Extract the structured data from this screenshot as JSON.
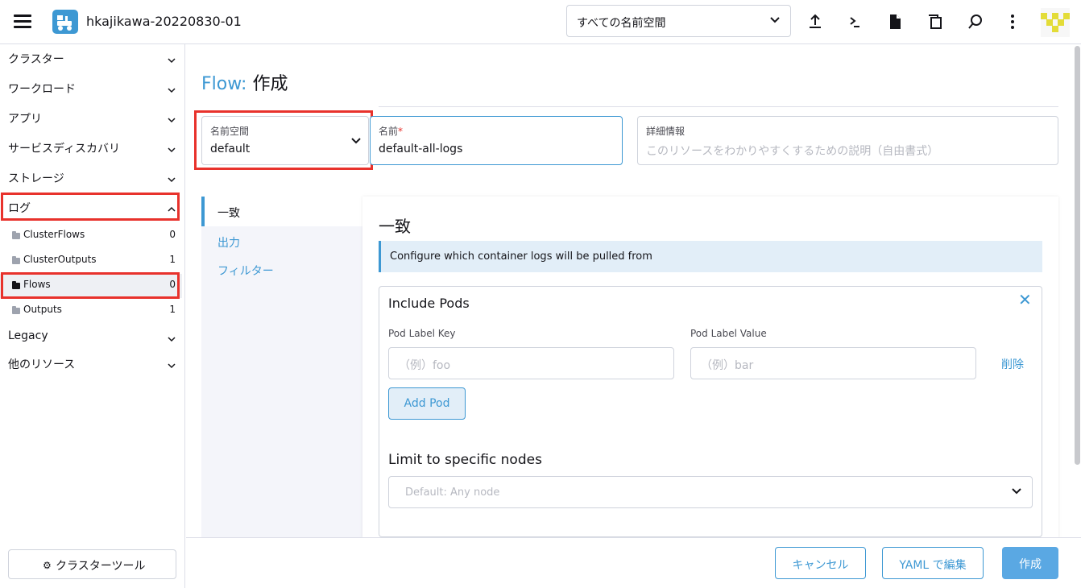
{
  "header": {
    "cluster_name": "hkajikawa-20220830-01",
    "namespace_filter": "すべての名前空間"
  },
  "sidebar": {
    "groups": [
      {
        "label": "クラスター"
      },
      {
        "label": "ワークロード"
      },
      {
        "label": "アプリ"
      },
      {
        "label": "サービスディスカバリ"
      },
      {
        "label": "ストレージ"
      },
      {
        "label": "ログ"
      }
    ],
    "log_items": [
      {
        "label": "ClusterFlows",
        "count": "0"
      },
      {
        "label": "ClusterOutputs",
        "count": "1"
      },
      {
        "label": "Flows",
        "count": "0"
      },
      {
        "label": "Outputs",
        "count": "1"
      }
    ],
    "groups_after": [
      {
        "label": "Legacy"
      },
      {
        "label": "他のリソース"
      }
    ],
    "tools_button": "クラスターツール"
  },
  "page": {
    "title_prefix": "Flow:",
    "title_action": "作成",
    "namespace": {
      "label": "名前空間",
      "value": "default"
    },
    "name": {
      "label": "名前",
      "required_mark": "*",
      "value": "default-all-logs"
    },
    "description": {
      "label": "詳細情報",
      "placeholder": "このリソースをわかりやすくするための説明（自由書式）"
    }
  },
  "tabs": [
    {
      "label": "一致"
    },
    {
      "label": "出力"
    },
    {
      "label": "フィルター"
    }
  ],
  "match": {
    "title": "一致",
    "banner": "Configure which container logs will be pulled from",
    "include_pods": {
      "title": "Include Pods",
      "key_label": "Pod Label Key",
      "value_label": "Pod Label Value",
      "key_placeholder": "（例）foo",
      "value_placeholder": "（例）bar",
      "remove": "削除",
      "add_button": "Add Pod"
    },
    "limit_nodes": {
      "title": "Limit to specific nodes",
      "placeholder": "Default: Any node"
    }
  },
  "footer": {
    "cancel": "キャンセル",
    "yaml": "YAML で編集",
    "create": "作成"
  },
  "colors": {
    "accent": "#3d98d3",
    "highlight_box": "#e8322c"
  }
}
